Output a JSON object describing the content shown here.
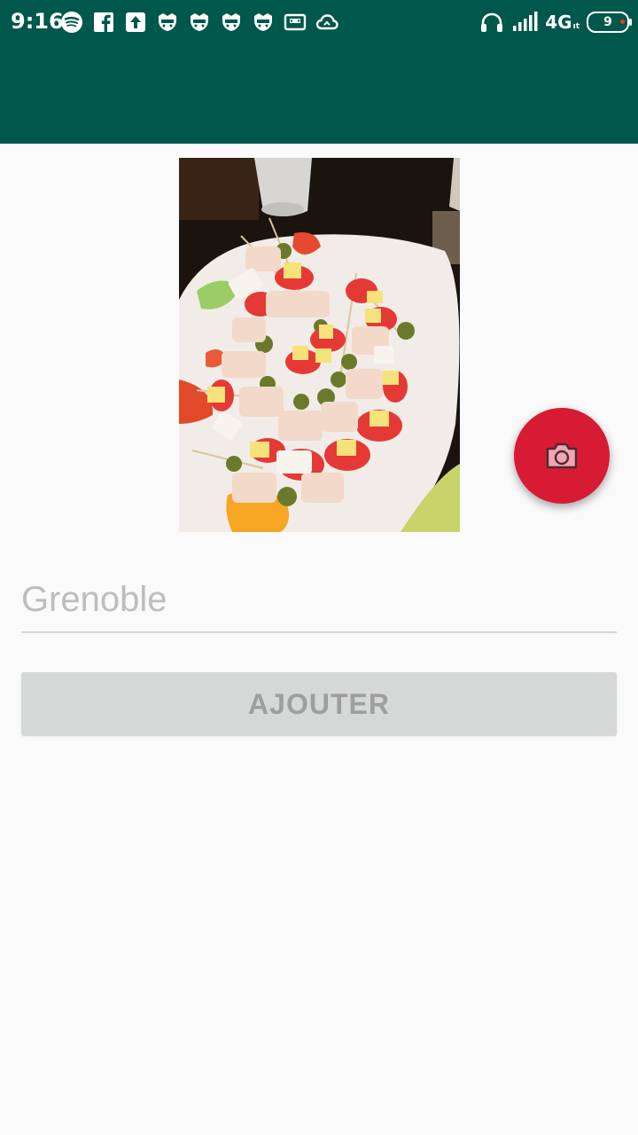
{
  "status_bar": {
    "time": "9:16",
    "network": "4G",
    "network_sub": "ıt",
    "battery": "9",
    "notification_icons": [
      "spotify-icon",
      "facebook-icon",
      "upload-icon",
      "game-icon",
      "game-icon",
      "game-icon",
      "game-icon",
      "cassette-icon",
      "cloud-icon"
    ],
    "right_icons": [
      "headphones-icon",
      "signal-icon",
      "battery-icon"
    ]
  },
  "app_bar": {
    "color": "#00574b"
  },
  "photo": {
    "description_icon": "food-plate-image"
  },
  "fab": {
    "icon": "camera-icon",
    "color": "#d81b35"
  },
  "form": {
    "city_placeholder": "Grenoble",
    "city_value": ""
  },
  "actions": {
    "add_label": "AJOUTER"
  }
}
